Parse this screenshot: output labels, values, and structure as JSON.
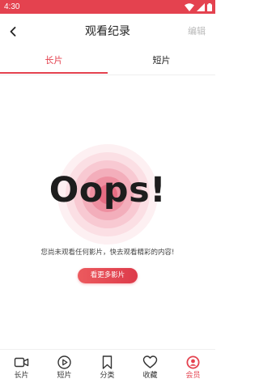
{
  "status_bar": {
    "time": "4:30",
    "background": "#e4424f",
    "icons": [
      "wifi-icon",
      "cellular-signal-icon",
      "battery-icon"
    ]
  },
  "header": {
    "back_icon": "back-arrow-icon",
    "title": "观看纪录",
    "edit_label": "编辑"
  },
  "tabs": [
    {
      "label": "长片",
      "active": true
    },
    {
      "label": "短片",
      "active": false
    }
  ],
  "empty_state": {
    "headline": "Oops!",
    "message": "您尚未观看任何影片，快去观看精彩的内容!",
    "button_label": "看更多影片"
  },
  "bottom_nav": {
    "items": [
      {
        "label": "长片",
        "icon": "video-camera-icon",
        "active": false
      },
      {
        "label": "短片",
        "icon": "play-circle-icon",
        "active": false
      },
      {
        "label": "分类",
        "icon": "bookmark-icon",
        "active": false
      },
      {
        "label": "收藏",
        "icon": "heart-icon",
        "active": false
      },
      {
        "label": "会员",
        "icon": "user-profile-icon",
        "active": true
      }
    ]
  },
  "colors": {
    "accent": "#e4424f",
    "text": "#222222",
    "muted": "#b9b9b9"
  }
}
